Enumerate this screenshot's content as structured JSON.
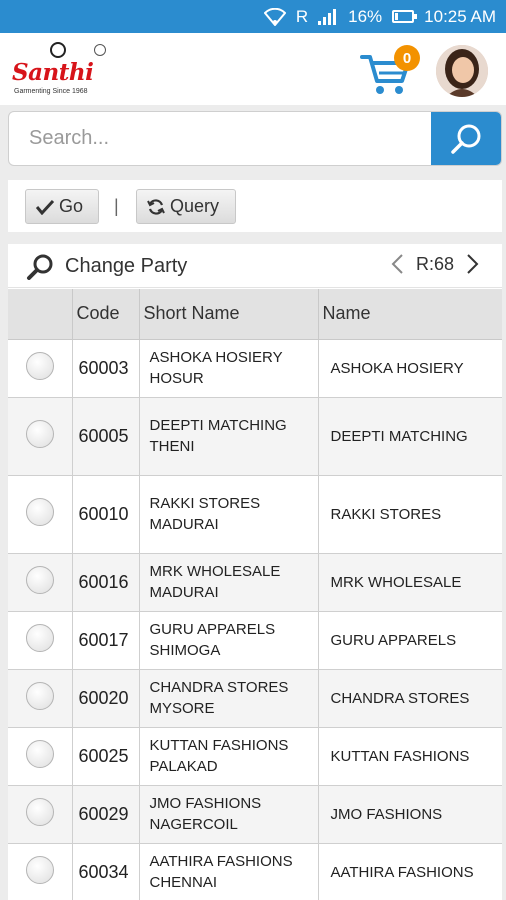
{
  "status_bar": {
    "network": "R",
    "battery": "16%",
    "battery_level": 0.16,
    "time": "10:25 AM",
    "icons": [
      "wifi-icon",
      "signal-icon",
      "battery-icon"
    ]
  },
  "header": {
    "brand": "Santhi",
    "tagline": "Garmenting Since 1968",
    "cart_count": "0",
    "accent": "#2b8ccf",
    "badge_color": "#f39200"
  },
  "search": {
    "placeholder": "Search...",
    "value": ""
  },
  "toolbar": {
    "go_label": "Go",
    "separator": "|",
    "query_label": "Query"
  },
  "party": {
    "title": "Change Party",
    "record_count": "R:68"
  },
  "table": {
    "headers": [
      "",
      "Code",
      "Short Name",
      "Name"
    ],
    "rows": [
      {
        "code": "60003",
        "short_line1": "ASHOKA HOSIERY",
        "short_line2": "HOSUR",
        "name": "ASHOKA HOSIERY"
      },
      {
        "code": "60005",
        "short_line1": "DEEPTI MATCHING",
        "short_line2": "THENI",
        "name": "DEEPTI MATCHING"
      },
      {
        "code": "60010",
        "short_line1": "RAKKI STORES",
        "short_line2": "MADURAI",
        "name": "RAKKI STORES"
      },
      {
        "code": "60016",
        "short_line1": "MRK WHOLESALE",
        "short_line2": "MADURAI",
        "name": "MRK WHOLESALE"
      },
      {
        "code": "60017",
        "short_line1": "GURU APPARELS",
        "short_line2": "SHIMOGA",
        "name": "GURU APPARELS"
      },
      {
        "code": "60020",
        "short_line1": "CHANDRA STORES",
        "short_line2": "MYSORE",
        "name": "CHANDRA STORES"
      },
      {
        "code": "60025",
        "short_line1": "KUTTAN FASHIONS",
        "short_line2": "PALAKAD",
        "name": "KUTTAN FASHIONS"
      },
      {
        "code": "60029",
        "short_line1": "JMO FASHIONS",
        "short_line2": "NAGERCOIL",
        "name": "JMO FASHIONS"
      },
      {
        "code": "60034",
        "short_line1": "AATHIRA FASHIONS",
        "short_line2": "CHENNAI",
        "name": "AATHIRA FASHIONS"
      }
    ]
  }
}
